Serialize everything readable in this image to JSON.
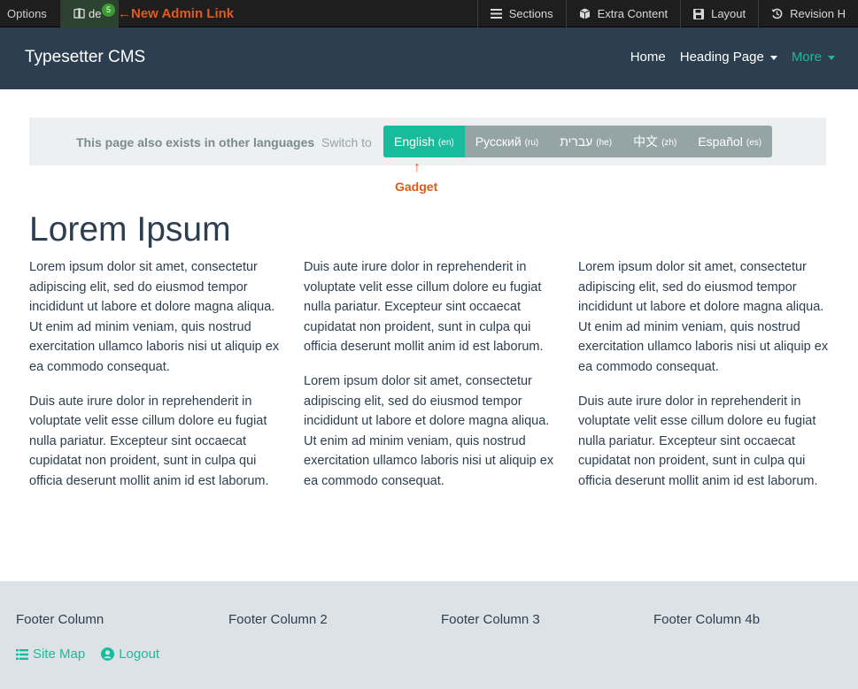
{
  "adminbar": {
    "options_label": "Options",
    "user_label": "de",
    "badge_count": "5",
    "annotation": "←New Admin Link",
    "buttons": [
      {
        "icon": "sections-icon",
        "label": "Sections"
      },
      {
        "icon": "cube-icon",
        "label": "Extra Content"
      },
      {
        "icon": "save-icon",
        "label": "Layout"
      },
      {
        "icon": "history-icon",
        "label": "Revision H"
      }
    ]
  },
  "navbar": {
    "brand": "Typesetter CMS",
    "items": [
      {
        "label": "Home",
        "dropdown": false,
        "active": false
      },
      {
        "label": "Heading Page",
        "dropdown": true,
        "active": false
      },
      {
        "label": "More",
        "dropdown": true,
        "active": true
      }
    ]
  },
  "languages": {
    "notice": "This page also exists in other languages",
    "switch_label": "Switch to",
    "options": [
      {
        "name": "English",
        "code": "(en)",
        "active": true
      },
      {
        "name": "Русский",
        "code": "(ru)",
        "active": false
      },
      {
        "name": "עברית",
        "code": "(he)",
        "active": false
      },
      {
        "name": "中文",
        "code": "(zh)",
        "active": false
      },
      {
        "name": "Español",
        "code": "(es)",
        "active": false
      }
    ],
    "gadget_arrow": "↑",
    "gadget_label": "Gadget"
  },
  "content": {
    "title": "Lorem Ipsum",
    "columns": [
      [
        "Lorem ipsum dolor sit amet, consectetur adipiscing elit, sed do eiusmod tempor incididunt ut labore et dolore magna aliqua. Ut enim ad minim veniam, quis nostrud exercitation ullamco laboris nisi ut aliquip ex ea commodo consequat.",
        "Duis aute irure dolor in reprehenderit in voluptate velit esse cillum dolore eu fugiat nulla pariatur. Excepteur sint occaecat cupidatat non proident, sunt in culpa qui officia deserunt mollit anim id est laborum."
      ],
      [
        "Duis aute irure dolor in reprehenderit in voluptate velit esse cillum dolore eu fugiat nulla pariatur. Excepteur sint occaecat cupidatat non proident, sunt in culpa qui officia deserunt mollit anim id est laborum.",
        "Lorem ipsum dolor sit amet, consectetur adipiscing elit, sed do eiusmod tempor incididunt ut labore et dolore magna aliqua. Ut enim ad minim veniam, quis nostrud exercitation ullamco laboris nisi ut aliquip ex ea commodo consequat."
      ],
      [
        "Lorem ipsum dolor sit amet, consectetur adipiscing elit, sed do eiusmod tempor incididunt ut labore et dolore magna aliqua. Ut enim ad minim veniam, quis nostrud exercitation ullamco laboris nisi ut aliquip ex ea commodo consequat.",
        "Duis aute irure dolor in reprehenderit in voluptate velit esse cillum dolore eu fugiat nulla pariatur. Excepteur sint occaecat cupidatat non proident, sunt in culpa qui officia deserunt mollit anim id est laborum."
      ]
    ]
  },
  "footer": {
    "columns": [
      "Footer Column",
      "Footer Column 2",
      "Footer Column 3",
      "Footer Column 4b"
    ],
    "links": [
      {
        "icon": "list-icon",
        "label": "Site Map"
      },
      {
        "icon": "user-circle-icon",
        "label": "Logout"
      }
    ]
  },
  "colors": {
    "navbar": "#2c3e50",
    "accent": "#18bc9c",
    "annotation": "#e05a1e",
    "lang_inactive": "#95a5a6",
    "footer": "#dde2e6"
  }
}
